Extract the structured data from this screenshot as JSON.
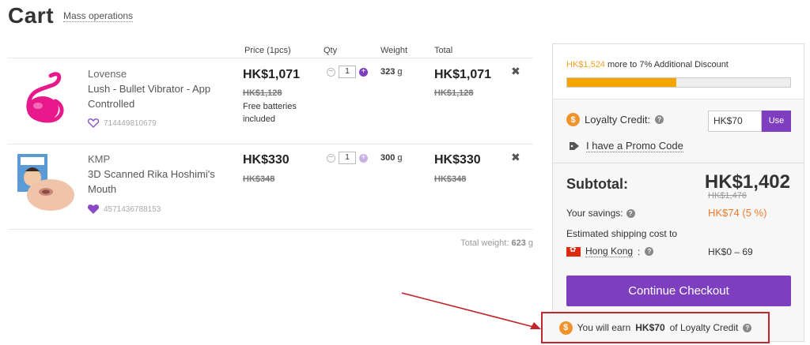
{
  "header": {
    "title": "Cart",
    "mass_operations": "Mass operations"
  },
  "columns": {
    "price": "Price (1pcs)",
    "qty": "Qty",
    "weight": "Weight",
    "total": "Total"
  },
  "items": [
    {
      "brand": "Lovense",
      "name": "Lush - Bullet Vibrator - App Controlled",
      "sku": "714449810679",
      "price": "HK$1,071",
      "old_price": "HK$1,128",
      "note": "Free batteries included",
      "qty": "1",
      "weight_value": "323",
      "weight_unit": "g",
      "total": "HK$1,071",
      "old_total": "HK$1,128",
      "favorite": false
    },
    {
      "brand": "KMP",
      "name": "3D Scanned Rika Hoshimi's Mouth",
      "sku": "4571436788153",
      "price": "HK$330",
      "old_price": "HK$348",
      "note": "",
      "qty": "1",
      "weight_value": "300",
      "weight_unit": "g",
      "total": "HK$330",
      "old_total": "HK$348",
      "favorite": true
    }
  ],
  "total_weight": {
    "label": "Total weight:",
    "value": "623",
    "unit": "g"
  },
  "summary": {
    "discount_amount": "HK$1,524",
    "discount_text": "more to 7% Additional Discount",
    "discount_progress": 0.49,
    "loyalty_label": "Loyalty Credit:",
    "loyalty_value": "HK$70",
    "use_label": "Use",
    "promo_label": "I have a Promo Code",
    "subtotal_label": "Subtotal:",
    "subtotal": "HK$1,402",
    "subtotal_old": "HK$1,476",
    "savings_label": "Your savings:",
    "savings": "HK$74 (5 %)",
    "shipping_label": "Estimated shipping cost to",
    "shipping_country": "Hong Kong",
    "shipping_cost": "HK$0 – 69",
    "checkout_label": "Continue Checkout"
  },
  "earn": {
    "prefix": "You will earn",
    "amount": "HK$70",
    "suffix": "of Loyalty Credit"
  },
  "colors": {
    "accent": "#7d3fbf",
    "orange": "#f5a400",
    "annotation": "#c0262b"
  },
  "icons": {
    "coin": "$",
    "help": "?",
    "remove": "✖",
    "minus": "−",
    "plus": "+"
  }
}
